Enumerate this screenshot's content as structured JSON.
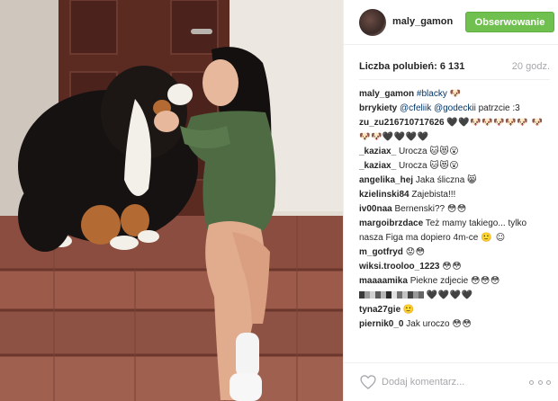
{
  "post": {
    "username": "maly_gamon",
    "follow_label": "Obserwowanie",
    "likes_label": "Liczba polubień:",
    "likes_count": "6 131",
    "time_ago": "20 godz.",
    "comment_placeholder": "Dodaj komentarz...",
    "accent_color": "#70c050",
    "link_color": "#003569"
  },
  "comments": [
    {
      "author": "maly_gamon",
      "tag": "#blacky",
      "text": "",
      "emoji": "🐶"
    },
    {
      "author": "brrykiety",
      "tag": "@cfeliik @godeckii",
      "text": "patrzcie :3",
      "emoji": ""
    },
    {
      "author": "zu_zu216710717626",
      "tag": "",
      "text": "",
      "emoji": "🖤🖤🐶🐶🐶🐶🐶 🐶🐶🐶🖤🖤🖤🖤"
    },
    {
      "author": "_kaziax_",
      "tag": "",
      "text": "Urocza",
      "emoji": "🐱😻😮"
    },
    {
      "author": "_kaziax_",
      "tag": "",
      "text": "Urocza",
      "emoji": "🐱😻😮"
    },
    {
      "author": "angelika_hej",
      "tag": "",
      "text": "Jaka śliczna",
      "emoji": "😸"
    },
    {
      "author": "kzielinski84",
      "tag": "",
      "text": "Zajebista!!!",
      "emoji": ""
    },
    {
      "author": "iv00naa",
      "tag": "",
      "text": "Bernenski??",
      "emoji": "😳😳"
    },
    {
      "author": "margoibrzdace",
      "tag": "",
      "text": "Też mamy takiego... tylko nasza Figa ma dopiero 4m-ce",
      "emoji": "🙂 ☺"
    },
    {
      "author": "m_gotfryd",
      "tag": "",
      "text": "",
      "emoji": "😟😳"
    },
    {
      "author": "wiksi.trooloo_1223",
      "tag": "",
      "text": "",
      "emoji": "😳😳"
    },
    {
      "author": "maaaamika",
      "tag": "",
      "text": "Piekne zdjecie",
      "emoji": "😳😳😳"
    },
    {
      "author": "",
      "tag": "",
      "text": "",
      "emoji": "🖤🖤🖤🖤"
    },
    {
      "author": "tyna27gie",
      "tag": "",
      "text": "",
      "emoji": "🙂"
    },
    {
      "author": "piernik0_0",
      "tag": "",
      "text": "Jak uroczo",
      "emoji": "😳😳"
    }
  ],
  "icons": {
    "heart": "heart-outline-icon",
    "more": "more-options-icon"
  }
}
